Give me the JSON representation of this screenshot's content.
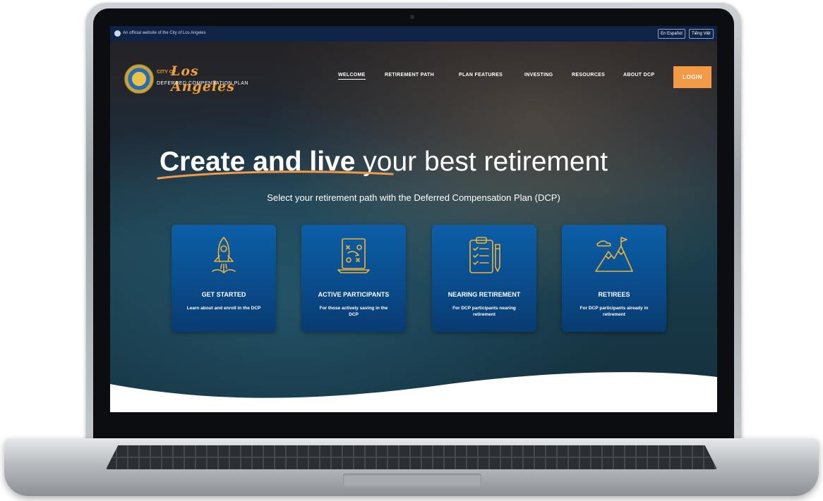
{
  "top_bar": {
    "gov_text": "An official website of the City of Los Angeles",
    "lang_1": "En Español",
    "lang_2": "Tiếng Việt"
  },
  "logo": {
    "city": "CITY OF",
    "name": "Los Angeles",
    "plan": "DEFERRED COMPENSATION PLAN"
  },
  "nav": {
    "items": [
      "WELCOME",
      "RETIREMENT PATH",
      "PLAN FEATURES",
      "INVESTING",
      "RESOURCES",
      "ABOUT DCP"
    ],
    "active": "WELCOME",
    "login": "LOGIN"
  },
  "hero": {
    "headline_bold": "Create and live",
    "headline_rest": " your best retirement",
    "subhead": "Select your retirement path with the Deferred Compensation Plan (DCP)"
  },
  "cards": [
    {
      "icon": "rocket-icon",
      "title": "GET STARTED",
      "desc": "Learn about and enroll in the DCP"
    },
    {
      "icon": "strategy-board-icon",
      "title": "ACTIVE PARTICIPANTS",
      "desc": "For those actively saving in the DCP"
    },
    {
      "icon": "clipboard-checklist-icon",
      "title": "NEARING RETIREMENT",
      "desc": "For DCP participants nearing retirement"
    },
    {
      "icon": "mountain-flag-icon",
      "title": "RETIREES",
      "desc": "For DCP participants already in retirement"
    }
  ],
  "colors": {
    "top_bar": "#0e2345",
    "accent_orange": "#f29a45",
    "card_blue": "#0a4c8c",
    "icon_gold": "#f2b233"
  }
}
